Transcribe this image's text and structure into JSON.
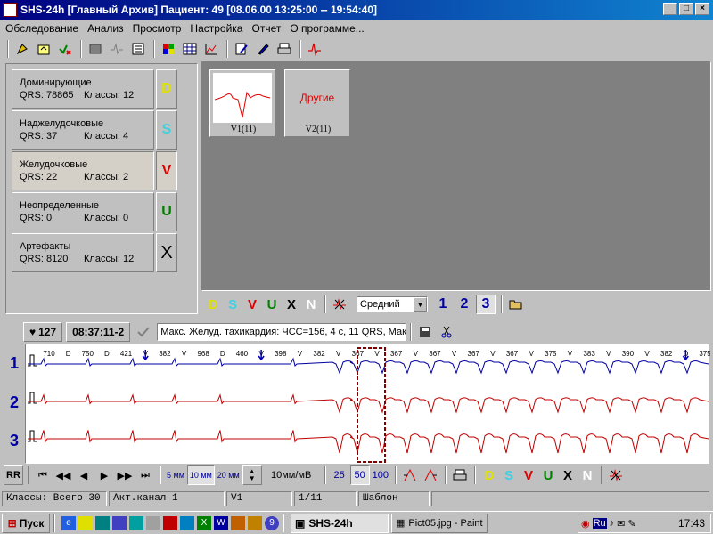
{
  "window": {
    "title": "SHS-24h [Главный Архив] Пациент: 49 [08.06.00 13:25:00 -- 19:54:40]"
  },
  "menu": [
    "Обследование",
    "Анализ",
    "Просмотр",
    "Настройка",
    "Отчет",
    "О программе..."
  ],
  "classes": [
    {
      "name": "Доминирующие",
      "qrs": "QRS: 78865",
      "classes": "Классы: 12",
      "letter": "D",
      "color": "#e0e000",
      "selected": false
    },
    {
      "name": "Наджелудочковые",
      "qrs": "QRS: 37",
      "classes": "Классы: 4",
      "letter": "S",
      "color": "#40d0e0",
      "selected": false
    },
    {
      "name": "Желудочковые",
      "qrs": "QRS: 22",
      "classes": "Классы: 2",
      "letter": "V",
      "color": "#e00000",
      "selected": true
    },
    {
      "name": "Неопределенные",
      "qrs": "QRS: 0",
      "classes": "Классы: 0",
      "letter": "U",
      "color": "#008000",
      "selected": false
    },
    {
      "name": "Артефакты",
      "qrs": "QRS: 8120",
      "classes": "Классы: 12",
      "letter": "X",
      "color": "#000000",
      "selected": false
    }
  ],
  "templates": [
    {
      "caption": "V1(11)",
      "kind": "waveform"
    },
    {
      "caption": "V2(11)",
      "kind": "text",
      "text": "Другие"
    }
  ],
  "classbar": {
    "letters": [
      {
        "t": "D",
        "c": "#e0e000"
      },
      {
        "t": "S",
        "c": "#40d0e0"
      },
      {
        "t": "V",
        "c": "#e00000"
      },
      {
        "t": "U",
        "c": "#008000"
      },
      {
        "t": "X",
        "c": "#000000"
      },
      {
        "t": "N",
        "c": "#ffffff"
      }
    ],
    "mode": "Средний",
    "numbers": [
      "1",
      "2",
      "3"
    ],
    "active_number": "3"
  },
  "ecg": {
    "heart_rate": "127",
    "time": "08:37:11-2",
    "description": "Макс. Желуд. тахикардия: ЧСС=156, 4 с, 11 QRS, Мак",
    "channels": [
      "1",
      "2",
      "3"
    ],
    "annotations": [
      {
        "t": "710",
        "b": false
      },
      {
        "t": "D",
        "b": false
      },
      {
        "t": "750",
        "b": false
      },
      {
        "t": "D",
        "b": false
      },
      {
        "t": "421",
        "b": false
      },
      {
        "t": "V",
        "b": true
      },
      {
        "t": "382",
        "b": false
      },
      {
        "t": "V",
        "b": false
      },
      {
        "t": "968",
        "b": false
      },
      {
        "t": "D",
        "b": false
      },
      {
        "t": "460",
        "b": false
      },
      {
        "t": "V",
        "b": true
      },
      {
        "t": "398",
        "b": false
      },
      {
        "t": "V",
        "b": false
      },
      {
        "t": "382",
        "b": false
      },
      {
        "t": "V",
        "b": false
      },
      {
        "t": "367",
        "b": false
      },
      {
        "t": "V",
        "b": false
      },
      {
        "t": "367",
        "b": false
      },
      {
        "t": "V",
        "b": false
      },
      {
        "t": "367",
        "b": false
      },
      {
        "t": "V",
        "b": false
      },
      {
        "t": "367",
        "b": false
      },
      {
        "t": "V",
        "b": false
      },
      {
        "t": "367",
        "b": false
      },
      {
        "t": "V",
        "b": false
      },
      {
        "t": "375",
        "b": false
      },
      {
        "t": "V",
        "b": false
      },
      {
        "t": "383",
        "b": false
      },
      {
        "t": "V",
        "b": false
      },
      {
        "t": "390",
        "b": false
      },
      {
        "t": "V",
        "b": false
      },
      {
        "t": "382",
        "b": false
      },
      {
        "t": "D",
        "b": true
      },
      {
        "t": "375",
        "b": false
      }
    ]
  },
  "nav": {
    "rr": "RR",
    "speeds": [
      "5 мм",
      "10 мм",
      "20 мм"
    ],
    "amplitude": "10мм/мВ",
    "zoom": [
      "25",
      "50",
      "100"
    ],
    "active_zoom": "50"
  },
  "status": {
    "classes_total": "Классы: Всего 30",
    "active_channel": "Акт.канал 1",
    "lead": "V1",
    "position": "1/11",
    "mode": "Шаблон"
  },
  "taskbar": {
    "start": "Пуск",
    "tasks": [
      {
        "label": "SHS-24h",
        "active": true
      },
      {
        "label": "Pict05.jpg - Paint",
        "active": false
      }
    ],
    "lang": "Ru",
    "clock": "17:43"
  }
}
